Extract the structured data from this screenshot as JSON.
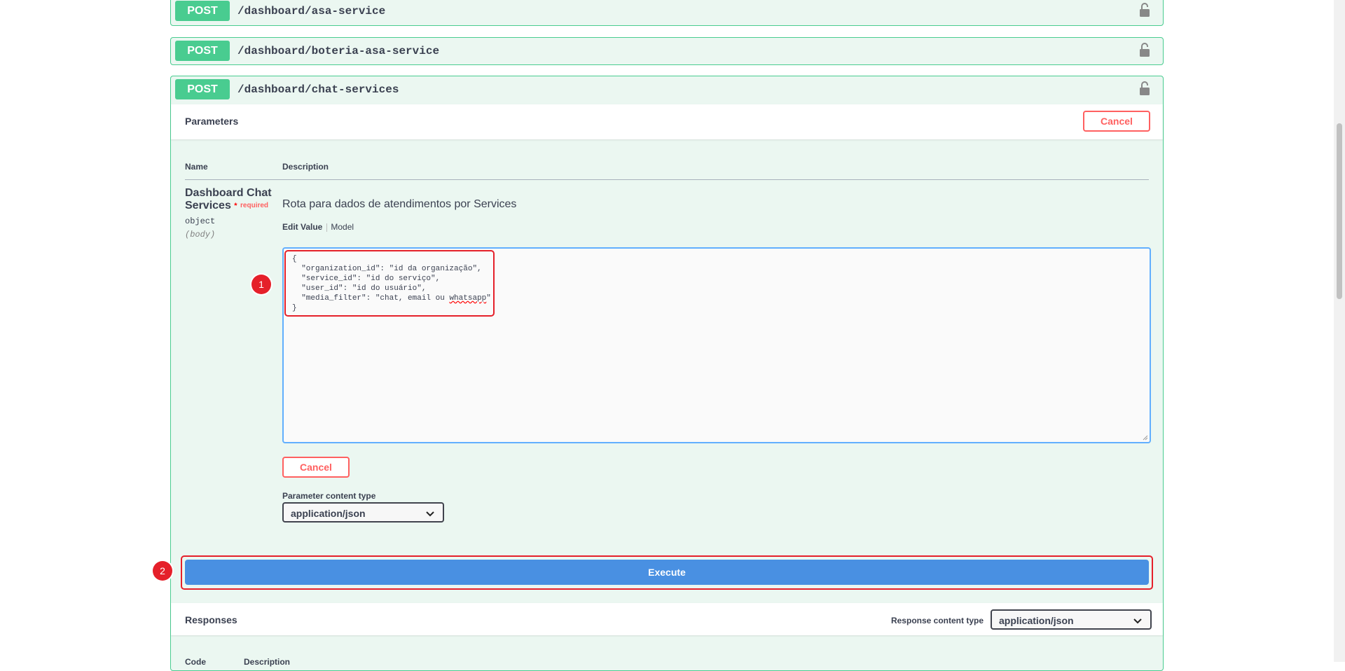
{
  "operations": [
    {
      "method": "POST",
      "path": "/dashboard/asa-service"
    },
    {
      "method": "POST",
      "path": "/dashboard/boteria-asa-service"
    },
    {
      "method": "POST",
      "path": "/dashboard/chat-services"
    }
  ],
  "parameters": {
    "title": "Parameters",
    "cancel_label": "Cancel",
    "col_name": "Name",
    "col_description": "Description",
    "param": {
      "name": "Dashboard Chat Services",
      "required_star": "*",
      "required_label": "required",
      "type": "object",
      "in": "(body)",
      "description": "Rota para dados de atendimentos por Services",
      "tab_edit": "Edit Value",
      "tab_model": "Model",
      "body_lines": [
        "{",
        "  \"organization_id\": \"id da organização\",",
        "  \"service_id\": \"id do serviço\",",
        "  \"user_id\": \"id do usuário\",",
        "  \"media_filter\": \"chat, email ou ",
        "}"
      ],
      "body_misspelled_word": "whatsapp",
      "body_line_end": "\""
    },
    "body_cancel_label": "Cancel",
    "content_type_label": "Parameter content type",
    "content_type_value": "application/json"
  },
  "execute_label": "Execute",
  "responses": {
    "title": "Responses",
    "content_type_label": "Response content type",
    "content_type_value": "application/json",
    "col_code": "Code",
    "col_description": "Description"
  },
  "annotations": {
    "step1": "1",
    "step2": "2"
  },
  "colors": {
    "post": "#49cc90",
    "post_bg": "#ebf7f1",
    "cancel": "#ff6060",
    "execute": "#4990e2",
    "highlight": "#e5202a"
  },
  "icons": [
    "lock-icon",
    "chevron-down-icon"
  ]
}
